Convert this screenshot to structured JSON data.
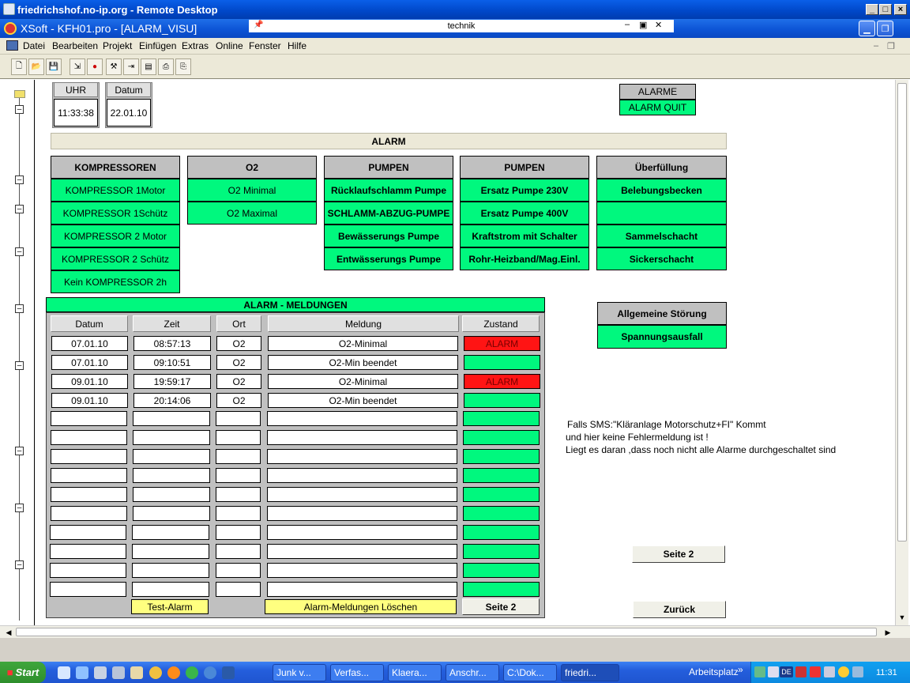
{
  "rdp_window": {
    "title": "friedrichshof.no-ip.org - Remote Desktop"
  },
  "xsoft_window": {
    "title": "XSoft - KFH01.pro - [ALARM_VISU]",
    "path_label": "technik"
  },
  "menu": [
    "Datei",
    "Bearbeiten",
    "Projekt",
    "Einfügen",
    "Extras",
    "Online",
    "Fenster",
    "Hilfe"
  ],
  "clock": {
    "uhr_label": "UHR",
    "uhr_value": "11:33:38",
    "datum_label": "Datum",
    "datum_value": "22.01.10"
  },
  "alarme_box": {
    "label": "ALARME",
    "quit_label": "ALARM QUIT"
  },
  "alarm_banner": "ALARM",
  "groups": [
    {
      "header": "KOMPRESSOREN",
      "items": [
        "KOMPRESSOR 1Motor",
        "KOMPRESSOR 1Schütz",
        "KOMPRESSOR 2 Motor",
        "KOMPRESSOR 2 Schütz",
        "Kein KOMPRESSOR 2h"
      ]
    },
    {
      "header": "O2",
      "items": [
        "O2 Minimal",
        "O2 Maximal"
      ]
    },
    {
      "header": "PUMPEN",
      "items": [
        "Rücklaufschlamm Pumpe",
        "SCHLAMM-ABZUG-PUMPE",
        "Bewässerungs Pumpe",
        "Entwässerungs Pumpe"
      ]
    },
    {
      "header": "PUMPEN",
      "items": [
        "Ersatz  Pumpe 230V",
        "Ersatz Pumpe 400V",
        "Kraftstrom mit Schalter",
        "Rohr-Heizband/Mag.Einl."
      ]
    },
    {
      "header": "Überfüllung",
      "items": [
        "Belebungsbecken",
        "",
        "Sammelschacht",
        "Sickerschacht"
      ]
    }
  ],
  "meldungen": {
    "title": "ALARM -  MELDUNGEN",
    "columns": [
      "Datum",
      "Zeit",
      "Ort",
      "Meldung",
      "Zustand"
    ],
    "rows": [
      {
        "datum": "07.01.10",
        "zeit": "08:57:13",
        "ort": "O2",
        "meldung": "O2-Minimal",
        "zustand": "ALARM"
      },
      {
        "datum": "07.01.10",
        "zeit": "09:10:51",
        "ort": "O2",
        "meldung": "O2-Min beendet",
        "zustand": ""
      },
      {
        "datum": "09.01.10",
        "zeit": "19:59:17",
        "ort": "O2",
        "meldung": "O2-Minimal",
        "zustand": "ALARM"
      },
      {
        "datum": "09.01.10",
        "zeit": "20:14:06",
        "ort": "O2",
        "meldung": "O2-Min beendet",
        "zustand": ""
      },
      {
        "datum": "",
        "zeit": "",
        "ort": "",
        "meldung": "",
        "zustand": ""
      },
      {
        "datum": "",
        "zeit": "",
        "ort": "",
        "meldung": "",
        "zustand": ""
      },
      {
        "datum": "",
        "zeit": "",
        "ort": "",
        "meldung": "",
        "zustand": ""
      },
      {
        "datum": "",
        "zeit": "",
        "ort": "",
        "meldung": "",
        "zustand": ""
      },
      {
        "datum": "",
        "zeit": "",
        "ort": "",
        "meldung": "",
        "zustand": ""
      },
      {
        "datum": "",
        "zeit": "",
        "ort": "",
        "meldung": "",
        "zustand": ""
      },
      {
        "datum": "",
        "zeit": "",
        "ort": "",
        "meldung": "",
        "zustand": ""
      },
      {
        "datum": "",
        "zeit": "",
        "ort": "",
        "meldung": "",
        "zustand": ""
      },
      {
        "datum": "",
        "zeit": "",
        "ort": "",
        "meldung": "",
        "zustand": ""
      },
      {
        "datum": "",
        "zeit": "",
        "ort": "",
        "meldung": "",
        "zustand": ""
      }
    ],
    "test_alarm": "Test-Alarm",
    "loeschen": "Alarm-Meldungen Löschen",
    "seite2": "Seite 2"
  },
  "stoerung": {
    "header": "Allgemeine Störung",
    "item": "Spannungsausfall"
  },
  "note": [
    "Falls SMS:\"Kläranlage Motorschutz+FI\" Kommt",
    "und hier keine Fehlermeldung ist !",
    "Liegt es daran ,dass noch nicht alle Alarme durchgeschaltet sind"
  ],
  "buttons": {
    "seite2": "Seite 2",
    "zurueck": "Zurück"
  },
  "taskbar": {
    "start": "Start",
    "tasks": [
      "Junk v...",
      "Verfas...",
      "Klaera...",
      "Anschr...",
      "C:\\Dok...",
      "friedri..."
    ],
    "arbeitsplatz": "Arbeitsplatz",
    "lang": "DE",
    "time": "11:31"
  },
  "colors": {
    "alarm_green": "#00f87e",
    "alarm_red": "#ff1414",
    "button_yellow": "#ffff80"
  }
}
